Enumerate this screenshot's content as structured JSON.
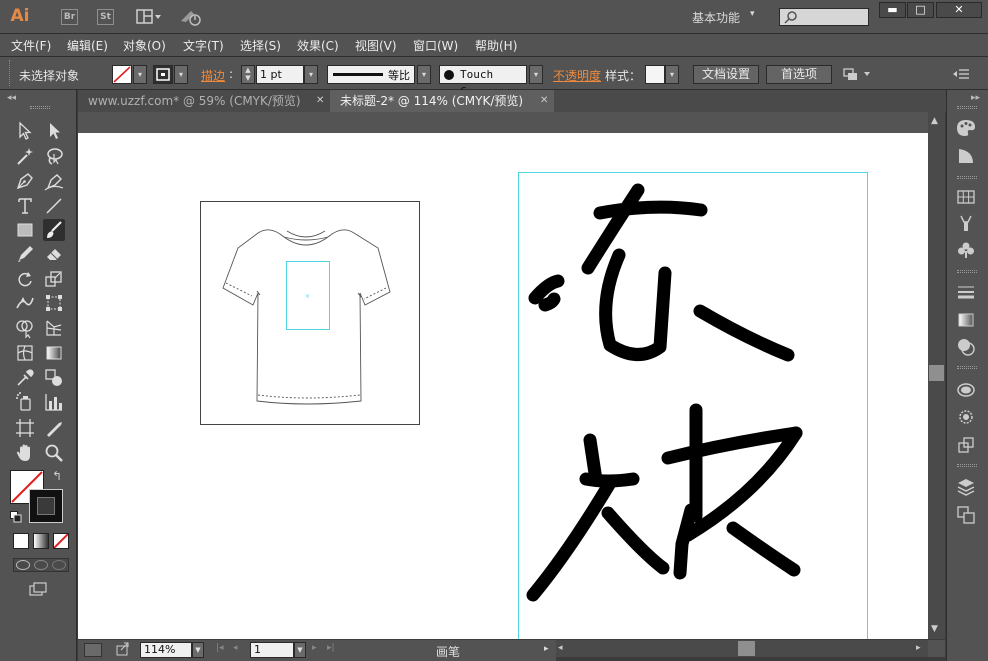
{
  "app": {
    "logo": "Ai",
    "badges": [
      "Br",
      "St"
    ],
    "workspace_label": "基本功能",
    "search_placeholder": ""
  },
  "menubar": {
    "items": [
      "文件(F)",
      "编辑(E)",
      "对象(O)",
      "文字(T)",
      "选择(S)",
      "效果(C)",
      "视图(V)",
      "窗口(W)",
      "帮助(H)"
    ]
  },
  "controlbar": {
    "selection_status": "未选择对象",
    "stroke_label": "描边",
    "stroke_weight": "1 pt",
    "stroke_profile": "等比",
    "brush_name": "Touch C...",
    "opacity_label": "不透明度",
    "style_label": "样式：",
    "doc_setup_button": "文档设置",
    "preferences_button": "首选项"
  },
  "tabs": [
    {
      "label": "www.uzzf.com* @ 59% (CMYK/预览)",
      "active": false
    },
    {
      "label": "未标题-2* @ 114% (CMYK/预览)",
      "active": true
    }
  ],
  "statusbar": {
    "zoom": "114%",
    "artboard_number": "1",
    "current_tool": "画笔"
  },
  "colors": {
    "accent_orange": "#f08a3a",
    "guide_cyan": "#4fd6e0",
    "ui_dark": "#535353"
  }
}
